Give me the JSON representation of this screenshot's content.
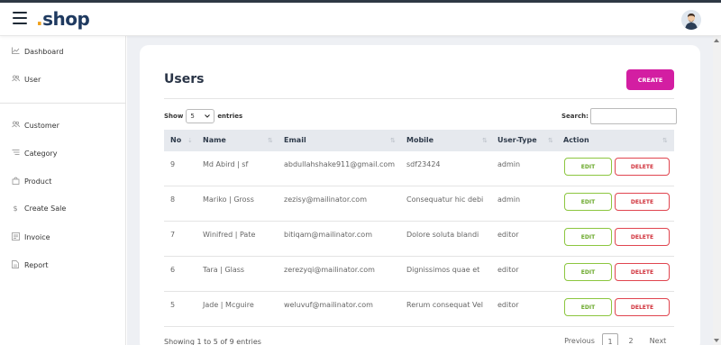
{
  "header": {
    "logo_dot": ".",
    "logo_text": "shop",
    "menu_icon": "hamburger-icon",
    "avatar_icon": "user-avatar-icon"
  },
  "sidebar": {
    "items": [
      {
        "label": "Dashboard",
        "icon": "chart-line-icon"
      },
      {
        "label": "User",
        "icon": "users-icon"
      },
      {
        "label": "Customer",
        "icon": "users-icon"
      },
      {
        "label": "Category",
        "icon": "list-icon"
      },
      {
        "label": "Product",
        "icon": "bag-icon"
      },
      {
        "label": "Create Sale",
        "icon": "dollar-icon"
      },
      {
        "label": "Invoice",
        "icon": "invoice-icon"
      },
      {
        "label": "Report",
        "icon": "report-icon"
      }
    ]
  },
  "main": {
    "title": "Users",
    "create_label": "CREATE",
    "show_label": "Show",
    "entries_value": "5",
    "entries_label": "entries",
    "search_label": "Search:",
    "search_value": "",
    "columns": [
      "No",
      "Name",
      "Email",
      "Mobile",
      "User-Type",
      "Action"
    ],
    "rows": [
      {
        "no": "9",
        "name": "Md Abird | sf",
        "email": "abdullahshake911@gmail.com",
        "mobile": "sdf23424",
        "type": "admin"
      },
      {
        "no": "8",
        "name": "Mariko | Gross",
        "email": "zezisy@mailinator.com",
        "mobile": "Consequatur hic debi",
        "type": "admin"
      },
      {
        "no": "7",
        "name": "Winifred | Pate",
        "email": "bitiqam@mailinator.com",
        "mobile": "Dolore soluta blandi",
        "type": "editor"
      },
      {
        "no": "6",
        "name": "Tara | Glass",
        "email": "zerezyqi@mailinator.com",
        "mobile": "Dignissimos quae et",
        "type": "editor"
      },
      {
        "no": "5",
        "name": "Jade | Mcguire",
        "email": "weluvuf@mailinator.com",
        "mobile": "Rerum consequat Vel",
        "type": "editor"
      }
    ],
    "edit_label": "EDIT",
    "delete_label": "DELETE",
    "info_text": "Showing 1 to 5 of 9 entries",
    "pagination": {
      "previous": "Previous",
      "pages": [
        "1",
        "2"
      ],
      "next": "Next",
      "current": "1"
    }
  },
  "colors": {
    "create": "#d31ea2",
    "edit": "#8cc63f",
    "delete": "#e0454f",
    "logo_dot": "#f0a11d",
    "logo": "#1f3a60"
  }
}
